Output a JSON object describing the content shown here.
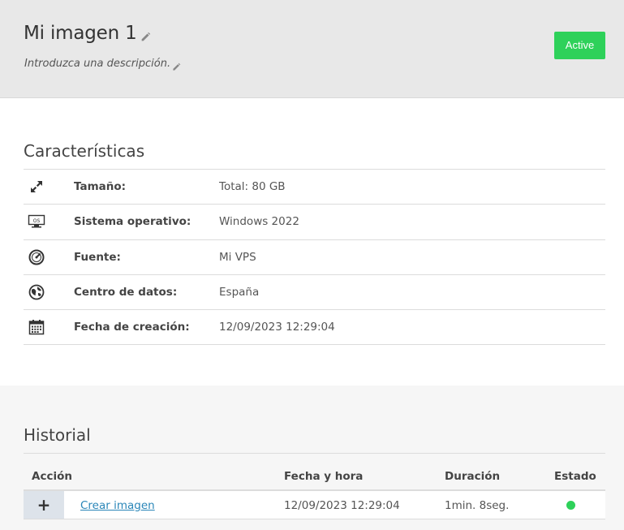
{
  "header": {
    "title": "Mi imagen 1",
    "description": "Introduzca una descripción.",
    "status_label": "Active",
    "status_color": "#2ed15a"
  },
  "features": {
    "title": "Características",
    "rows": [
      {
        "icon": "resize-arrows-icon",
        "label": "Tamaño:",
        "value": "Total: 80 GB"
      },
      {
        "icon": "os-monitor-icon",
        "label": "Sistema operativo:",
        "value": "Windows 2022"
      },
      {
        "icon": "gauge-icon",
        "label": "Fuente:",
        "value": "Mi VPS"
      },
      {
        "icon": "globe-icon",
        "label": "Centro de datos:",
        "value": "España"
      },
      {
        "icon": "calendar-icon",
        "label": "Fecha de creación:",
        "value": "12/09/2023 12:29:04"
      }
    ]
  },
  "history": {
    "title": "Historial",
    "columns": {
      "action": "Acción",
      "datetime": "Fecha y hora",
      "duration": "Duración",
      "status": "Estado"
    },
    "rows": [
      {
        "expand": "+",
        "action": "Crear imagen",
        "datetime": "12/09/2023 12:29:04",
        "duration": "1min. 8seg.",
        "status_color": "#2ed15a"
      }
    ]
  }
}
